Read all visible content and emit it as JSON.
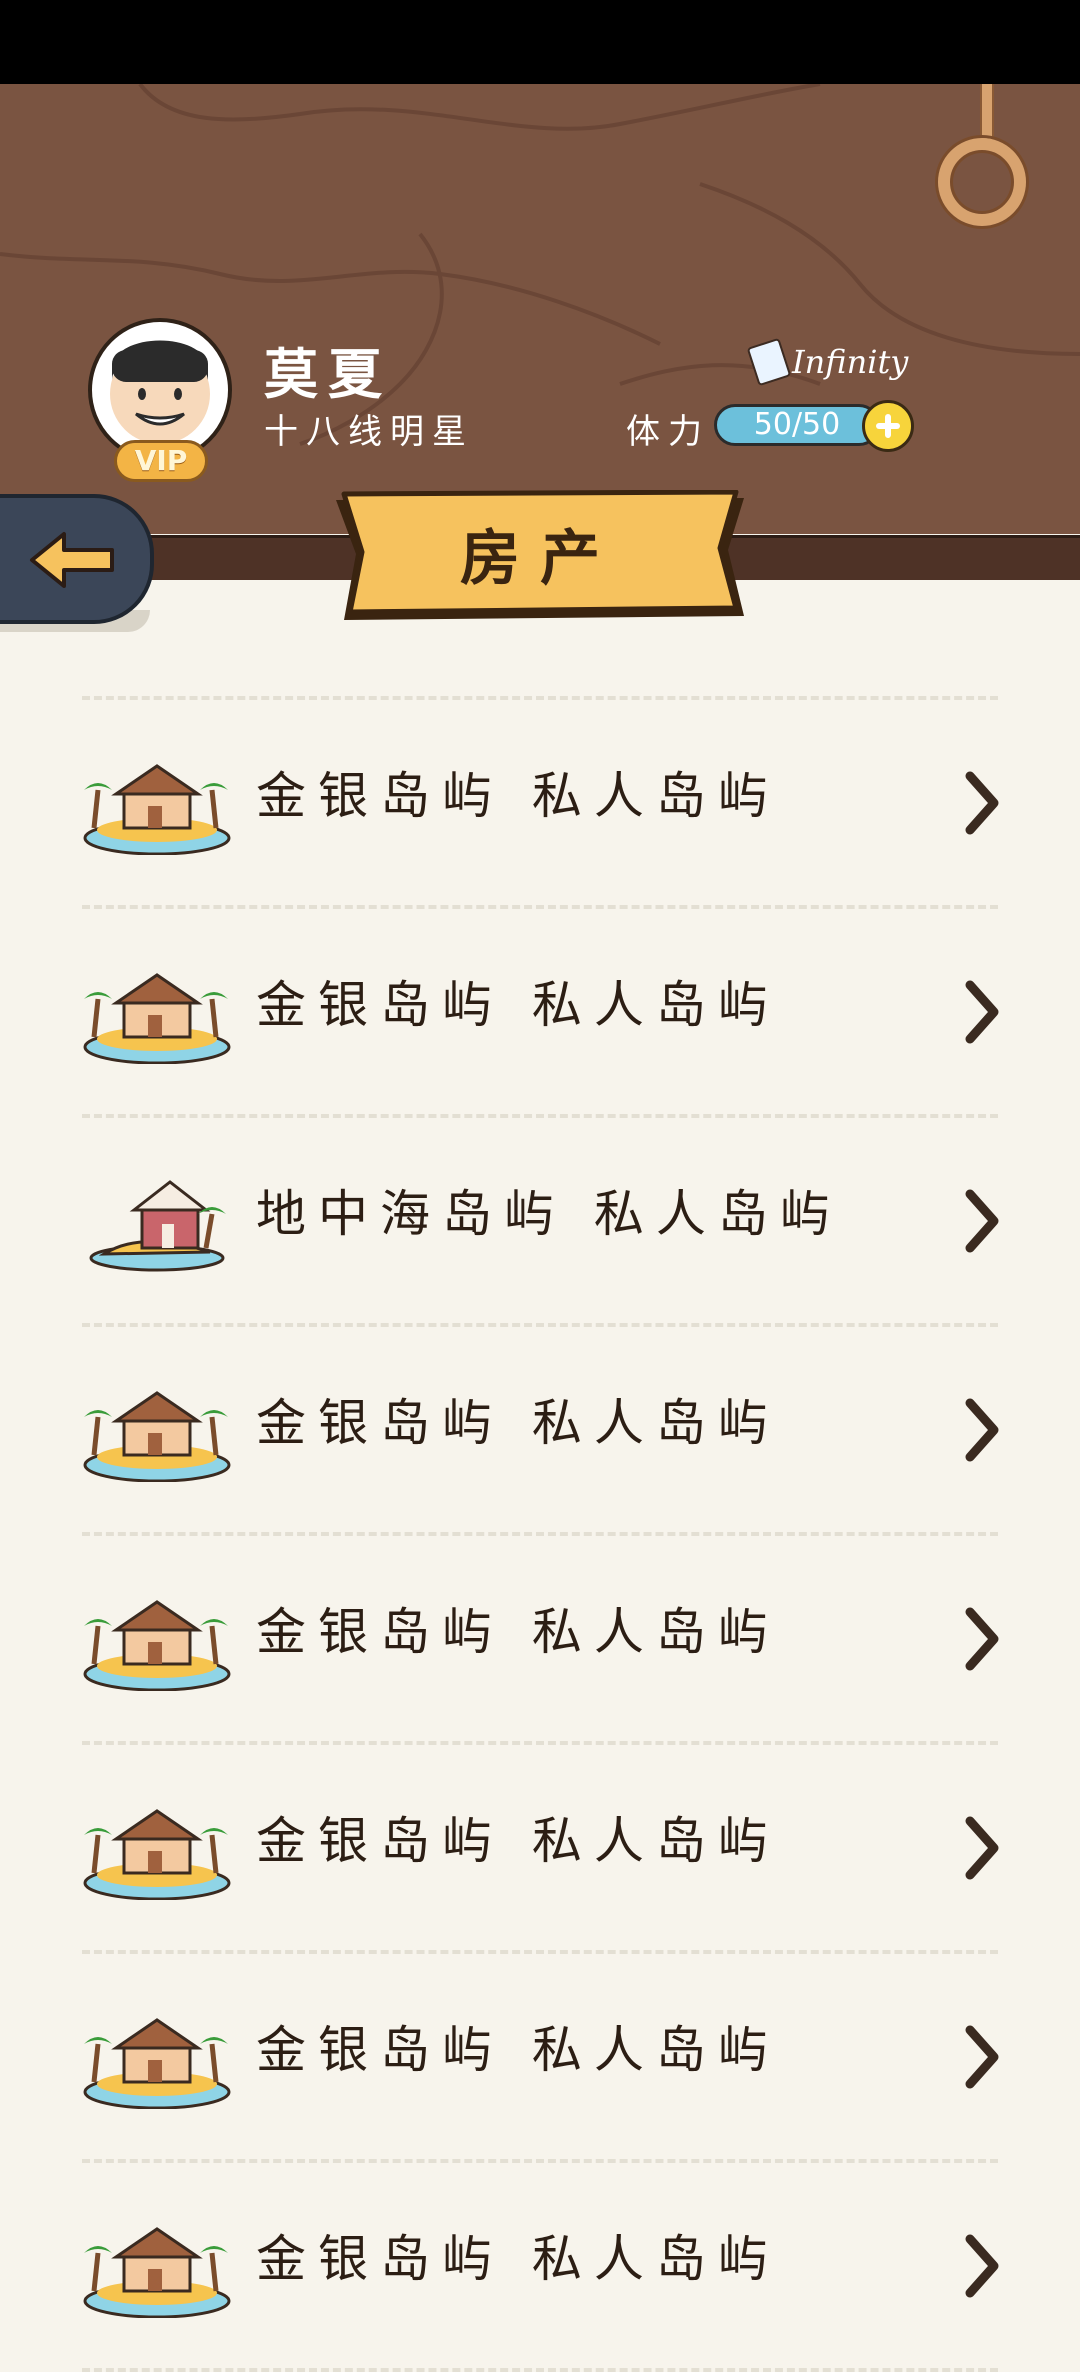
{
  "profile": {
    "name": "莫夏",
    "title": "十八线明星",
    "vip_label": "VIP"
  },
  "currency": {
    "infinity_label": "Infinity",
    "stamina_label": "体力",
    "stamina_value": "50/50"
  },
  "page": {
    "title": "房产"
  },
  "properties": [
    {
      "label": "金银岛屿  私人岛屿",
      "icon": "gold-island-icon"
    },
    {
      "label": "金银岛屿  私人岛屿",
      "icon": "gold-island-icon"
    },
    {
      "label": "地中海岛屿  私人岛屿",
      "icon": "mediterranean-island-icon"
    },
    {
      "label": "金银岛屿  私人岛屿",
      "icon": "gold-island-icon"
    },
    {
      "label": "金银岛屿  私人岛屿",
      "icon": "gold-island-icon"
    },
    {
      "label": "金银岛屿  私人岛屿",
      "icon": "gold-island-icon"
    },
    {
      "label": "金银岛屿  私人岛屿",
      "icon": "gold-island-icon"
    },
    {
      "label": "金银岛屿  私人岛屿",
      "icon": "gold-island-icon"
    }
  ],
  "colors": {
    "header_wood": "#7a5441",
    "banner_yellow": "#f6c25e",
    "stamina_blue": "#6cc0db",
    "back_button": "#3b4658",
    "background": "#f7f4ec"
  }
}
